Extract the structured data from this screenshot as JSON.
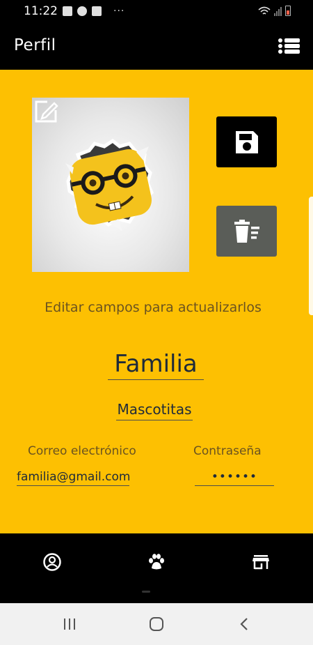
{
  "status_bar": {
    "time": "11:22",
    "more": "···"
  },
  "app_bar": {
    "title": "Perfil",
    "menu_icon": "list-icon"
  },
  "profile": {
    "avatar_icon": "nerd-face-emoji",
    "edit_photo_icon": "edit-icon",
    "save_icon": "floppy-disk-icon",
    "delete_icon": "trash-list-icon",
    "hint": "Editar campos para actualizarlos",
    "family_name": "Familia",
    "pet_name": "Mascotitas",
    "email_label": "Correo electrónico",
    "email_value": "familia@gmail.com",
    "password_label": "Contraseña",
    "password_value": "••••••"
  },
  "bottom_nav": {
    "items": [
      {
        "icon": "account-circle-icon"
      },
      {
        "icon": "paw-icon"
      },
      {
        "icon": "store-icon"
      }
    ]
  },
  "colors": {
    "background": "#fdc002",
    "app_bar": "#000000",
    "save_button": "#000000",
    "delete_button": "#5a5d58",
    "text_primary": "#1e2a3a",
    "text_secondary": "#6b5320"
  }
}
